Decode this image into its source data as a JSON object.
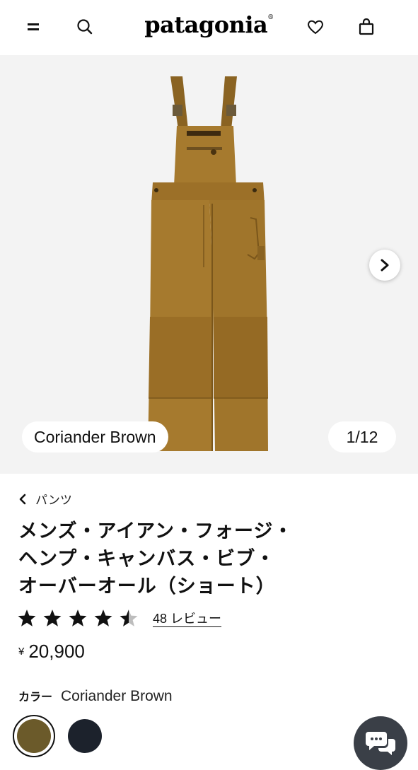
{
  "header": {
    "logo": "patagonia",
    "logo_mark": "®",
    "icons": [
      "menu-icon",
      "search-icon",
      "heart-icon",
      "bag-icon"
    ]
  },
  "gallery": {
    "color_name": "Coriander Brown",
    "counter": "1/12",
    "background": "#f3f3f3",
    "product_color": "#a67a2e"
  },
  "breadcrumb": {
    "label": "パンツ"
  },
  "product": {
    "title_lines": [
      "メンズ・アイアン・フォージ・",
      "ヘンプ・キャンバス・ビブ・",
      "オーバーオール（ショート）"
    ],
    "rating": 4.5,
    "review_link": "48 レビュー",
    "currency": "¥",
    "price": "20,900"
  },
  "color": {
    "label": "カラー",
    "selected": "Coriander Brown",
    "swatches": [
      {
        "name": "Coriander Brown",
        "hex": "#6b5a2a",
        "selected": true
      },
      {
        "name": "dark-navy",
        "hex": "#1c222c",
        "selected": false
      }
    ]
  }
}
